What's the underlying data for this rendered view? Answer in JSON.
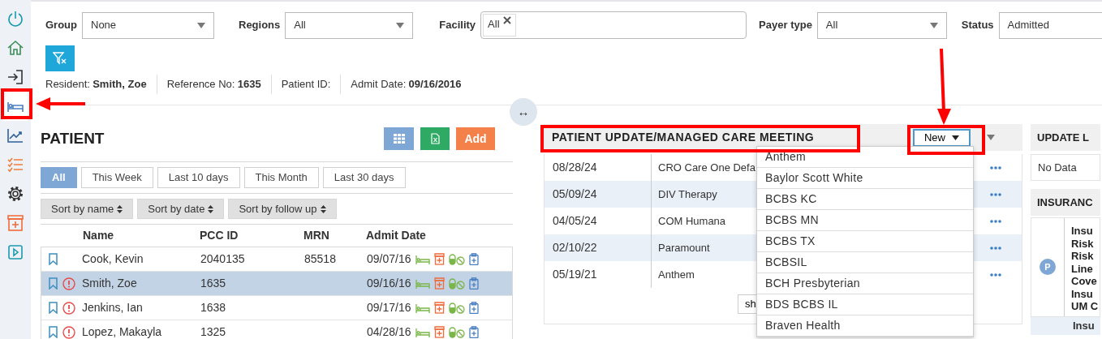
{
  "sidebar": {
    "items": [
      {
        "selected": false
      },
      {
        "selected": false
      },
      {
        "selected": false
      },
      {
        "selected": true
      },
      {
        "selected": false
      },
      {
        "selected": false
      },
      {
        "selected": false
      },
      {
        "selected": false
      },
      {
        "selected": false
      }
    ]
  },
  "filters": [
    {
      "label": "Group",
      "kind": "select",
      "value": "None"
    },
    {
      "label": "Regions",
      "kind": "select",
      "value": "All"
    },
    {
      "label": "Facility",
      "kind": "tags",
      "tags": [
        "All"
      ]
    },
    {
      "label": "Payer type",
      "kind": "select",
      "value": "All"
    },
    {
      "label": "Status",
      "kind": "select",
      "value": "Admitted"
    }
  ],
  "resident_info": [
    {
      "label": "Resident:",
      "value": "Smith, Zoe"
    },
    {
      "label": "Reference No:",
      "value": "1635"
    },
    {
      "label": "Patient ID:"
    },
    {
      "label": "Admit Date:",
      "value": "09/16/2016"
    }
  ],
  "resize_handle": "↔",
  "patient": {
    "title": "PATIENT",
    "add_button": "Add",
    "range_tabs": [
      {
        "label": "All",
        "selected": true
      },
      {
        "label": "This Week",
        "selected": false
      },
      {
        "label": "Last 10 days",
        "selected": false
      },
      {
        "label": "This Month",
        "selected": false
      },
      {
        "label": "Last 30 days",
        "selected": false
      }
    ],
    "sort_buttons": [
      "Sort by name",
      "Sort by date",
      "Sort by follow up"
    ],
    "columns": [
      "Name",
      "PCC ID",
      "MRN",
      "Admit Date"
    ],
    "rows": [
      {
        "name": "Cook, Kevin",
        "pcc_id": "2040135",
        "mrn": "85518",
        "admit_date": "09/07/16",
        "alert": false,
        "selected": false
      },
      {
        "name": "Smith, Zoe",
        "pcc_id": "1635",
        "admit_date": "09/16/16",
        "alert": true,
        "selected": true
      },
      {
        "name": "Jenkins, Ian",
        "pcc_id": "1638",
        "admit_date": "09/17/16",
        "alert": true,
        "selected": false
      },
      {
        "name": "Lopez, Makayla",
        "pcc_id": "1325",
        "admit_date": "04/28/16",
        "alert": true,
        "selected": false
      }
    ]
  },
  "meeting": {
    "title": "PATIENT UPDATE/MANAGED CARE MEETING",
    "new_button": "New",
    "rows": [
      {
        "date": "08/28/24",
        "name": "CRO Care One Defa"
      },
      {
        "date": "05/09/24",
        "name": "DIV Therapy"
      },
      {
        "date": "04/05/24",
        "name": "COM Humana"
      },
      {
        "date": "02/10/22",
        "name": "Paramount"
      },
      {
        "date": "05/19/21",
        "name": "Anthem"
      }
    ],
    "more_button": "sh",
    "dropdown": [
      "Anthem",
      "Baylor Scott White",
      "BCBS KC",
      "BCBS MN",
      "BCBS TX",
      "BCBSIL",
      "BCH Presbyterian",
      "BDS BCBS IL",
      "Braven Health"
    ]
  },
  "update_log": {
    "title": "UPDATE L",
    "empty_text": "No Data"
  },
  "insurance": {
    "title": "INSURANC",
    "avatar": "P",
    "lines": [
      "Insu",
      "Risk",
      "Risk",
      "Line",
      "Cove",
      "Insu",
      "UM C"
    ],
    "next_line": "Insu"
  }
}
